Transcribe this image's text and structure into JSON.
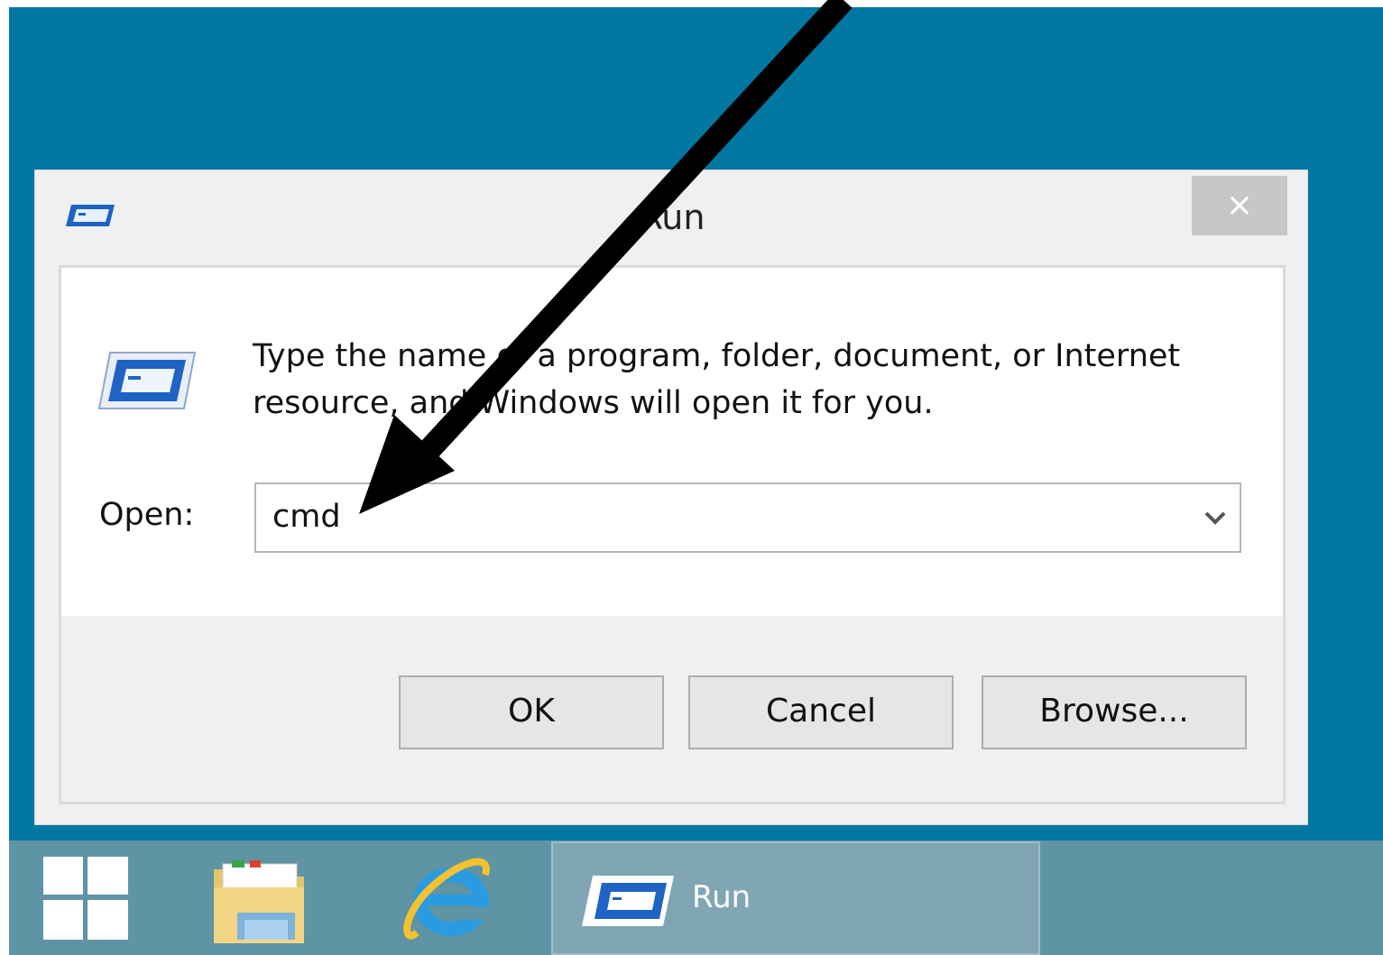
{
  "dialog": {
    "title": "Run",
    "close_symbol": "×",
    "description": "Type the name of a program, folder, document, or Internet resource, and Windows will open it for you.",
    "open_label": "Open:",
    "open_value": "cmd",
    "buttons": {
      "ok": "OK",
      "cancel": "Cancel",
      "browse": "Browse..."
    },
    "icon": "run-app-icon"
  },
  "taskbar": {
    "start_icon": "windows-logo-icon",
    "pinned": [
      "file-explorer-icon",
      "internet-explorer-icon"
    ],
    "running": {
      "label": "Run",
      "icon": "run-app-icon"
    }
  },
  "colors": {
    "desktop": "#0277a1",
    "taskbar": "#5e94a4",
    "taskbar_active": "#80a6b4",
    "dialog_bg": "#f0f0f0",
    "close_button": "#c7c7c7",
    "annotation_arrow": "#000000"
  }
}
